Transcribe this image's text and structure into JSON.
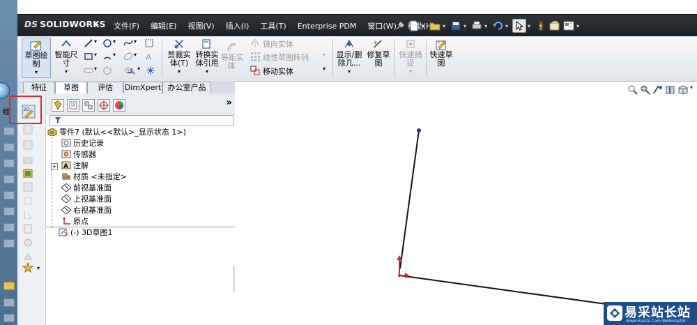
{
  "left_strip": {
    "label": "绘"
  },
  "titlebar": {
    "logo_brand": "SOLIDWORKS",
    "logo_prefix": "DS",
    "menu": [
      "文件(F)",
      "编辑(E)",
      "视图(V)",
      "插入(I)",
      "工具(T)",
      "Enterprise PDM",
      "窗口(W)",
      "帮助(H)"
    ]
  },
  "command_manager": {
    "sketch_label": "草图绘\n制",
    "smart_dim_label": "智能尺\n寸",
    "trim_label": "剪裁实\n体(T)",
    "convert_label": "转换实\n体引用",
    "offset_label": "等距实\n体",
    "mirror_label": "镜向实体",
    "linear_pattern_label": "线性草图阵列",
    "move_label": "移动实体",
    "show_delete_label": "显示/删\n除几...",
    "repair_label": "修复草\n图",
    "quick_snap_label": "快速捕\n捉",
    "rapid_sketch_label": "快速草\n图"
  },
  "tabs": [
    "特征",
    "草图",
    "评估",
    "DimXpert",
    "办公室产品"
  ],
  "active_tab": "草图",
  "feature_tree": {
    "part": "零件7 (默认<<默认>_显示状态 1>)",
    "items": [
      "历史记录",
      "传感器",
      "注解",
      "材质 <未指定>",
      "前视基准面",
      "上视基准面",
      "右视基准面",
      "原点"
    ],
    "sketch": "(-) 3D草图1"
  },
  "watermark": {
    "text": "易采站长站",
    "sub": "Www.Easck.Com  Webmaster"
  },
  "colors": {
    "title_bg": "#2f3539",
    "highlight": "#e0262b",
    "accent": "#1c4e8c"
  }
}
